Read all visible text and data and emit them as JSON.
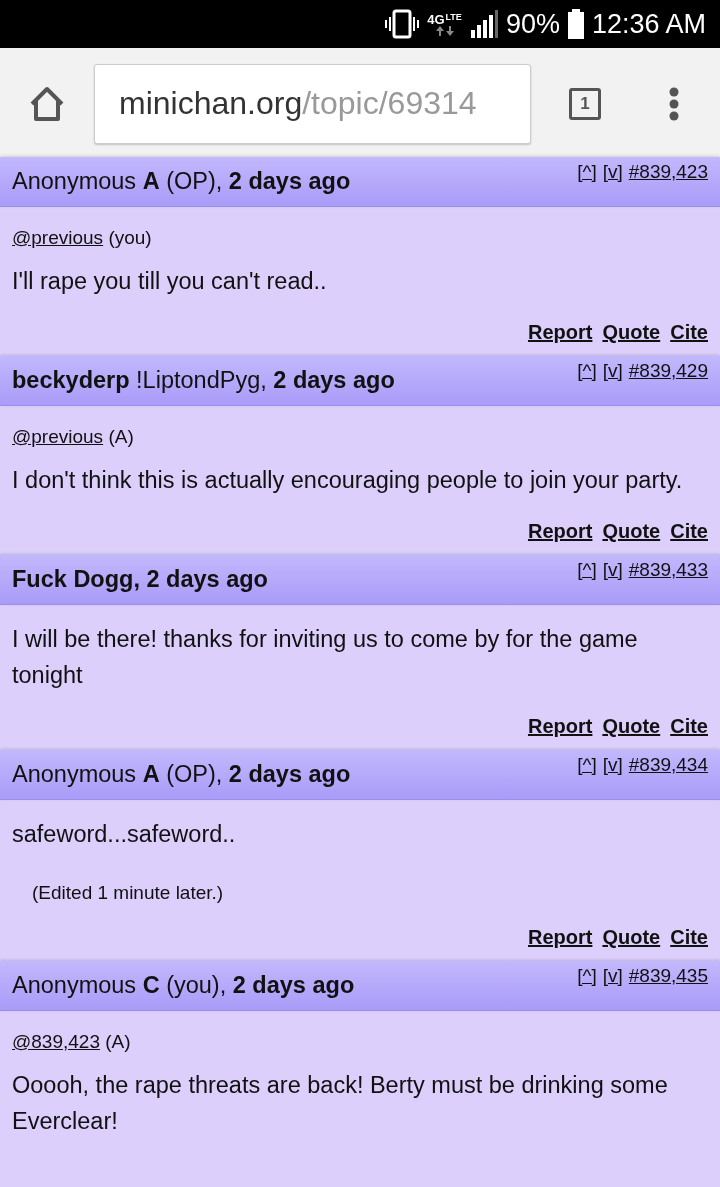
{
  "status_bar": {
    "network": "4G",
    "network_sub": "LTE",
    "battery": "90%",
    "time": "12:36 AM"
  },
  "browser": {
    "url_host": "minichan.org",
    "url_path": "/topic/69314",
    "tab_count": "1"
  },
  "posts": [
    {
      "header": "Anonymous **A** (OP), **2 days ago**",
      "nav": [
        "[^]",
        "[v]",
        "#839,423"
      ],
      "reply": {
        "link": "@previous",
        "note": "(you)"
      },
      "body": "I'll rape you till you can't read..",
      "actions": [
        "Report",
        "Quote",
        "Cite"
      ]
    },
    {
      "header": "**beckyderp** !LiptondPyg, **2 days ago**",
      "nav": [
        "[^]",
        "[v]",
        "#839,429"
      ],
      "reply": {
        "link": "@previous",
        "note": "(A)"
      },
      "body": "I don't think this is actually encouraging people to join your party.",
      "actions": [
        "Report",
        "Quote",
        "Cite"
      ]
    },
    {
      "header": "**Fuck Dogg, 2 days ago**",
      "nav": [
        "[^]",
        "[v]",
        "#839,433"
      ],
      "body": "I will be there! thanks for inviting us to come by for the game tonight",
      "actions": [
        "Report",
        "Quote",
        "Cite"
      ]
    },
    {
      "header": "Anonymous **A** (OP), **2 days ago**",
      "nav": [
        "[^]",
        "[v]",
        "#839,434"
      ],
      "body": "safeword...safeword..",
      "edited": "(Edited 1 minute later.)",
      "actions": [
        "Report",
        "Quote",
        "Cite"
      ]
    },
    {
      "header": "Anonymous **C** (you), **2 days ago**",
      "nav": [
        "[^]",
        "[v]",
        "#839,435"
      ],
      "reply": {
        "link": "@839,423",
        "note": "(A)"
      },
      "body": "Ooooh, the rape threats are back! Berty must be drinking some Everclear!"
    }
  ]
}
